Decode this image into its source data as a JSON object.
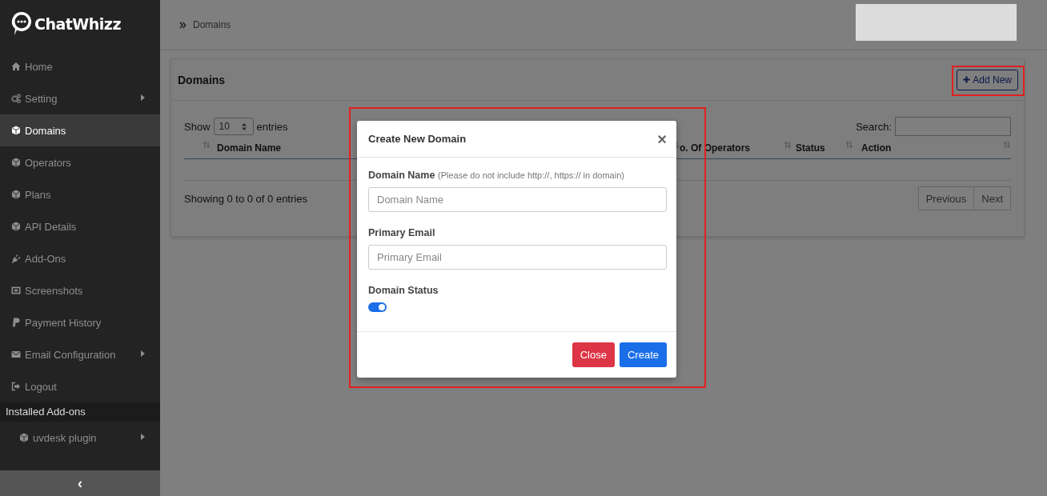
{
  "sidebar": {
    "brand": "ChatWhizz",
    "items": [
      {
        "label": "Home",
        "selected": false,
        "has_submenu": false
      },
      {
        "label": "Setting",
        "selected": false,
        "has_submenu": true
      },
      {
        "label": "Domains",
        "selected": true,
        "has_submenu": false
      },
      {
        "label": "Operators",
        "selected": false,
        "has_submenu": false
      },
      {
        "label": "Plans",
        "selected": false,
        "has_submenu": false
      },
      {
        "label": "API Details",
        "selected": false,
        "has_submenu": false
      },
      {
        "label": "Add-Ons",
        "selected": false,
        "has_submenu": false
      },
      {
        "label": "Screenshots",
        "selected": false,
        "has_submenu": false
      },
      {
        "label": "Payment History",
        "selected": false,
        "has_submenu": false
      },
      {
        "label": "Email Configuration",
        "selected": false,
        "has_submenu": true
      },
      {
        "label": "Logout",
        "selected": false,
        "has_submenu": false
      }
    ],
    "section_title": "Installed Add-ons",
    "addon_items": [
      {
        "label": "uvdesk plugin",
        "selected": false,
        "has_submenu": true
      }
    ],
    "collapse_icon": "‹"
  },
  "breadcrumb": {
    "label": "Domains"
  },
  "panel": {
    "title": "Domains",
    "add_button": {
      "label": "Add New",
      "highlighted": true
    },
    "length": {
      "label_before": "Show",
      "value": "10",
      "label_after": "entries"
    },
    "search": {
      "label": "Search:"
    },
    "columns": [
      {
        "sortable": true
      },
      {
        "label": "Domain Name",
        "sortable": true
      },
      {
        "label": "o. Of Operators",
        "sortable": true
      },
      {
        "label": "Status",
        "sortable": true
      },
      {
        "label": "Action",
        "sortable": true
      }
    ],
    "info": "Showing 0 to 0 of 0 entries",
    "pagination": [
      {
        "label": "Previous"
      },
      {
        "label": "Next"
      }
    ]
  },
  "modal": {
    "title": "Create New Domain",
    "close_icon": "×",
    "highlighted": true,
    "fields": [
      {
        "label": "Domain Name",
        "hint": "(Please do not include http://, https:// in domain)",
        "placeholder": "Domain Name"
      },
      {
        "label": "Primary Email",
        "placeholder": "Primary Email"
      }
    ],
    "status": {
      "label": "Domain Status",
      "on": true
    },
    "buttons": [
      {
        "label": "Close",
        "kind": "danger"
      },
      {
        "label": "Create",
        "kind": "primary"
      }
    ]
  }
}
